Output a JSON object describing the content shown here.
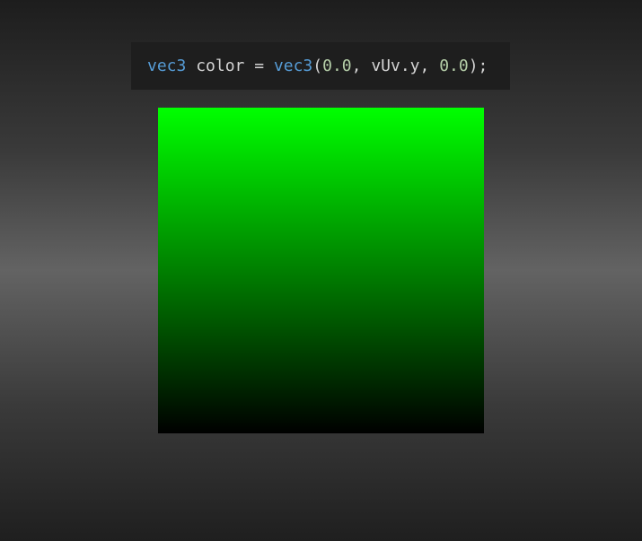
{
  "code": {
    "type_kw": "vec3",
    "var_part": " color = ",
    "ctor_kw": "vec3",
    "open_paren": "(",
    "arg1": "0.0",
    "comma1": ", ",
    "arg2": "vUv.y",
    "comma2": ", ",
    "arg3": "0.0",
    "close": ");"
  },
  "colors": {
    "background_center": "#636363",
    "background_edge": "#1d1d1d",
    "code_background": "#1e1e1e",
    "keyword": "#569cd6",
    "number": "#b5cea8",
    "plain": "#d4d4d4",
    "gradient_top": "#00ff00",
    "gradient_bottom": "#000000"
  }
}
